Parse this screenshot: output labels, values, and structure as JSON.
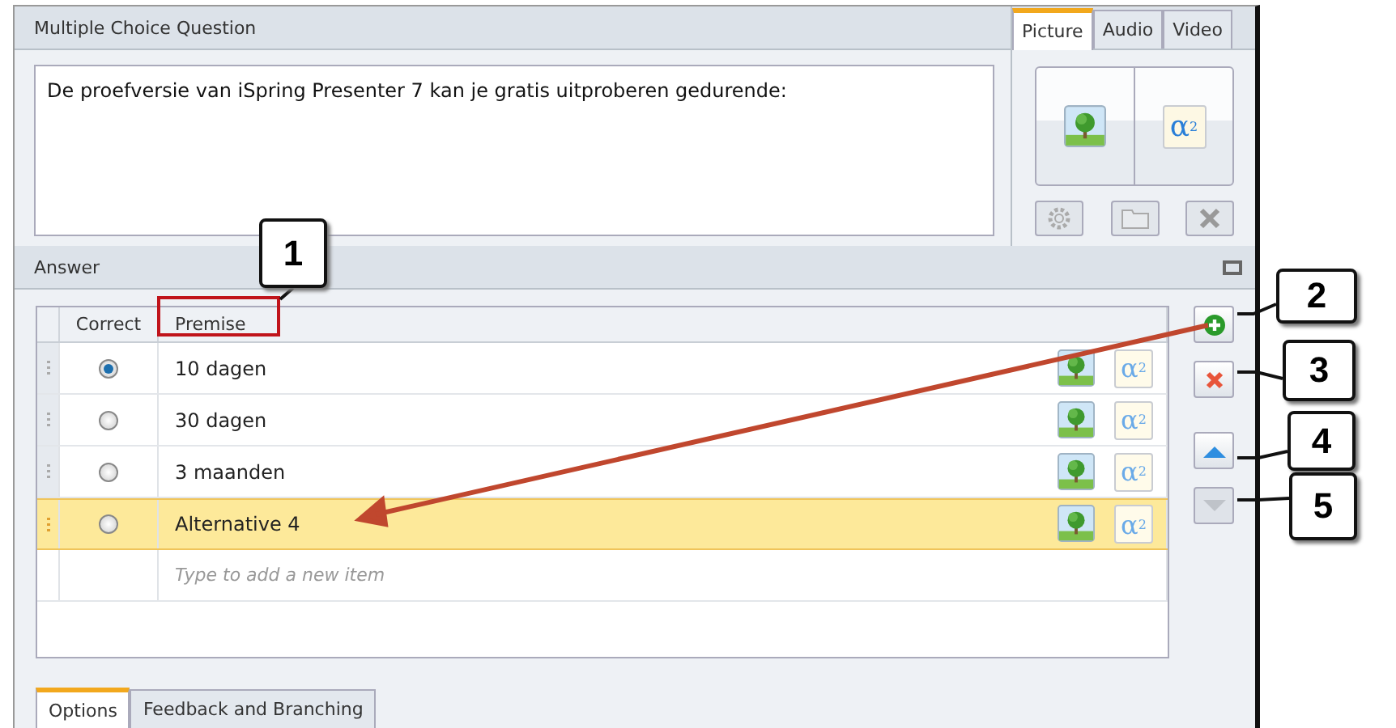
{
  "question_panel": {
    "title": "Multiple Choice Question",
    "question_text": "De proefversie van iSpring Presenter 7 kan je gratis uitproberen gedurende:"
  },
  "media_tabs": [
    {
      "label": "Picture",
      "selected": true
    },
    {
      "label": "Audio",
      "selected": false
    },
    {
      "label": "Video",
      "selected": false
    }
  ],
  "media_panel": {
    "formula": "α$^{2}$"
  },
  "answer_panel": {
    "title": "Answer",
    "columns": [
      "Correct",
      "Premise"
    ],
    "rows": [
      {
        "text": "10 dagen",
        "correct": true,
        "selected": false,
        "formula": "α$^{2}$"
      },
      {
        "text": "30 dagen",
        "correct": false,
        "selected": false,
        "formula": "α$^{2}$"
      },
      {
        "text": "3 maanden",
        "correct": false,
        "selected": false,
        "formula": "α$^{2}$"
      },
      {
        "text": "Alternative 4",
        "correct": false,
        "selected": true,
        "formula": "α$^{2}$"
      }
    ],
    "new_item": {
      "placeholder": "Type to add a new item"
    },
    "side_buttons": [
      {
        "kind": "add",
        "disabled": false
      },
      {
        "kind": "delete",
        "disabled": false
      },
      {
        "kind": "up",
        "disabled": false
      },
      {
        "kind": "down",
        "disabled": true
      }
    ]
  },
  "bottom_tabs": [
    {
      "label": "Options",
      "selected": true
    },
    {
      "label": "Feedback and Branching",
      "selected": false
    }
  ],
  "callouts": [
    {
      "label": "1"
    },
    {
      "label": "2"
    },
    {
      "label": "3"
    },
    {
      "label": "4"
    },
    {
      "label": "5"
    }
  ]
}
